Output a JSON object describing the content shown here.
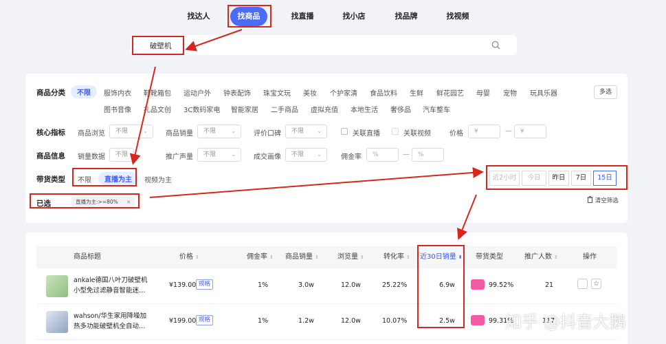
{
  "nav": {
    "items": [
      {
        "label": "找达人"
      },
      {
        "label": "找商品",
        "active": true
      },
      {
        "label": "找直播"
      },
      {
        "label": "找小店"
      },
      {
        "label": "找品牌"
      },
      {
        "label": "找视频"
      }
    ]
  },
  "search": {
    "value": "破壁机",
    "icon": "search-icon"
  },
  "filters": {
    "category": {
      "label": "商品分类",
      "items": [
        "不限",
        "服饰内衣",
        "鞋靴箱包",
        "运动户外",
        "钟表配饰",
        "珠宝文玩",
        "美妆",
        "个护家清",
        "食品饮料",
        "生鲜",
        "鲜花园艺",
        "母婴",
        "宠物",
        "玩具乐器",
        "图书音像",
        "礼品文创",
        "3C数码家电",
        "智能家居",
        "二手商品",
        "虚拟充值",
        "本地生活",
        "奢侈品",
        "汽车整车"
      ],
      "selected": "不限",
      "multi_label": "多选"
    },
    "core": {
      "label": "核心指标",
      "fields": [
        {
          "label": "商品浏览",
          "value": "不限"
        },
        {
          "label": "商品销量",
          "value": "不限"
        },
        {
          "label": "评价口碑",
          "value": "不限"
        }
      ],
      "checkboxes": [
        "关联直播",
        "关联视频"
      ],
      "price_label": "价格",
      "price_min_placeholder": "¥",
      "price_max_placeholder": "¥",
      "dash": "—"
    },
    "info": {
      "label": "商品信息",
      "fields": [
        {
          "label": "销量数据",
          "value": "不限"
        },
        {
          "label": "推广声量",
          "value": "不限"
        },
        {
          "label": "成交画像",
          "value": "不限"
        }
      ],
      "commission_label": "佣金率",
      "commission_min_placeholder": "%",
      "commission_max_placeholder": "%",
      "dash": "—"
    },
    "type": {
      "label": "带货类型",
      "options": [
        "不限",
        "直播为主",
        "视频为主"
      ],
      "selected": "直播为主"
    },
    "time_range": {
      "options": [
        "近2小时",
        "今日",
        "昨日",
        "7日",
        "15日"
      ],
      "selected": "15日"
    },
    "selected_row": {
      "label": "已选",
      "tag": "直播为主:>=80%",
      "tag_close": "×",
      "clear_label": "清空筛选"
    }
  },
  "table": {
    "headers": [
      "商品标题",
      "价格",
      "佣金率",
      "商品销量",
      "浏览量",
      "转化率",
      "近30日销量",
      "带货类型",
      "推广人数",
      "操作"
    ],
    "sort_active": "近30日销量",
    "rows": [
      {
        "title": "ankale德国八叶刀破壁机小型免过滤静音智能迷…",
        "price": "¥139.00",
        "spec": "规格",
        "commission": "1%",
        "sales": "3.0w",
        "views": "12.0w",
        "conversion": "25.22%",
        "sales30": "6.9w",
        "live_ratio": "99.52%",
        "promoters": "21"
      },
      {
        "title": "wahson/华生家用降噪加热多功能破壁机全自动…",
        "price": "¥199.00",
        "spec": "规格",
        "commission": "1%",
        "sales": "1.2w",
        "views": "12.0w",
        "conversion": "10.07%",
        "sales30": "2.5w",
        "live_ratio": "99.31%",
        "promoters": "117"
      }
    ]
  },
  "watermark": "知乎 @抖音大鹅",
  "colors": {
    "accent": "#4a6cf7",
    "annotation": "#d9261c",
    "douyin": "#f35aa2"
  }
}
